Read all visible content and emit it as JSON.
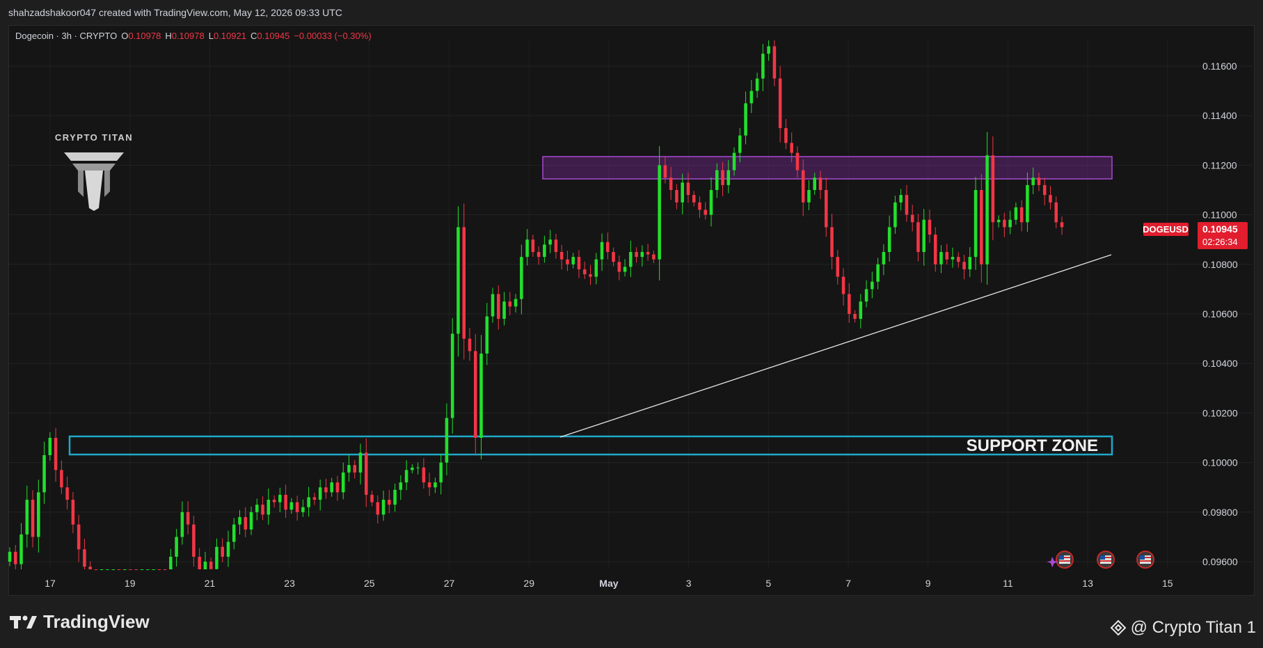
{
  "header": {
    "text": "shahzadshakoor047 created with TradingView.com, May 12, 2026 09:33 UTC"
  },
  "legend": {
    "symbol": "Dogecoin · 3h · CRYPTO",
    "o_label": "O",
    "o_value": "0.10978",
    "h_label": "H",
    "h_value": "0.10978",
    "l_label": "L",
    "l_value": "0.10921",
    "c_label": "C",
    "c_value": "0.10945",
    "change": "−0.00033 (−0.30%)"
  },
  "brand": {
    "name": "CRYPTO TITAN"
  },
  "annotations": {
    "support_label": "SUPPORT ZONE"
  },
  "price_tag": {
    "symbol": "DOGEUSD",
    "price": "0.10945",
    "countdown": "02:26:34"
  },
  "footer": {
    "logo_text": "TradingView",
    "credit": "@ Crypto Titan 1"
  },
  "colors": {
    "up": "#22e02c",
    "down": "#f23645",
    "resistance": "#a64bd1",
    "support": "#1fa9c9",
    "trendline": "#e6e6e6",
    "price_tag": "#e11d2e"
  },
  "chart_data": {
    "type": "candlestick",
    "yticks": [
      "0.09600",
      "0.09800",
      "0.10000",
      "0.10200",
      "0.10400",
      "0.10600",
      "0.10800",
      "0.11000",
      "0.11200",
      "0.11400",
      "0.11600"
    ],
    "ylim": [
      0.0955,
      0.1171
    ],
    "x_labels": [
      "17",
      "19",
      "21",
      "23",
      "25",
      "27",
      "29",
      "May",
      "3",
      "5",
      "7",
      "9",
      "11",
      "13",
      "15"
    ],
    "closes": [
      0.0964,
      0.0959,
      0.0971,
      0.0985,
      0.097,
      0.0988,
      0.1003,
      0.101,
      0.0997,
      0.099,
      0.0985,
      0.0975,
      0.0965,
      0.0958,
      0.0952,
      0.095,
      0.095,
      0.0951,
      0.0951,
      0.095,
      0.0953,
      0.0952,
      0.095,
      0.0951,
      0.0951,
      0.0952,
      0.0951,
      0.0949,
      0.0962,
      0.097,
      0.098,
      0.0975,
      0.0962,
      0.0955,
      0.096,
      0.0957,
      0.0966,
      0.0962,
      0.0968,
      0.0975,
      0.0978,
      0.0973,
      0.098,
      0.0983,
      0.0979,
      0.0985,
      0.0984,
      0.0987,
      0.0981,
      0.0984,
      0.098,
      0.0982,
      0.0986,
      0.0985,
      0.099,
      0.0988,
      0.0992,
      0.0988,
      0.0996,
      0.0999,
      0.0996,
      0.1004,
      0.0987,
      0.0984,
      0.0979,
      0.0985,
      0.0983,
      0.0989,
      0.0992,
      0.0997,
      0.0998,
      0.0998,
      0.0992,
      0.099,
      0.0992,
      0.1,
      0.1018,
      0.1052,
      0.1095,
      0.105,
      0.1045,
      0.101,
      0.1044,
      0.1059,
      0.1068,
      0.1058,
      0.1065,
      0.1063,
      0.1066,
      0.1083,
      0.109,
      0.1085,
      0.1083,
      0.1088,
      0.109,
      0.1085,
      0.1082,
      0.108,
      0.1083,
      0.1078,
      0.1076,
      0.1075,
      0.1082,
      0.1089,
      0.1085,
      0.1081,
      0.1077,
      0.1079,
      0.1085,
      0.1083,
      0.1085,
      0.1084,
      0.1082,
      0.112,
      0.1115,
      0.111,
      0.1105,
      0.1113,
      0.1108,
      0.1105,
      0.1102,
      0.11,
      0.111,
      0.1118,
      0.1112,
      0.1118,
      0.1125,
      0.1132,
      0.1145,
      0.115,
      0.1155,
      0.1165,
      0.1168,
      0.1155,
      0.1135,
      0.1129,
      0.1125,
      0.1118,
      0.1105,
      0.111,
      0.1115,
      0.111,
      0.1095,
      0.1083,
      0.1075,
      0.1068,
      0.106,
      0.1058,
      0.1065,
      0.107,
      0.1073,
      0.108,
      0.1085,
      0.1095,
      0.1105,
      0.1108,
      0.11,
      0.1097,
      0.1085,
      0.1098,
      0.1092,
      0.108,
      0.1085,
      0.1082,
      0.1083,
      0.1081,
      0.1078,
      0.1083,
      0.111,
      0.108,
      0.1124,
      0.1097,
      0.1098,
      0.1095,
      0.1098,
      0.1103,
      0.1097,
      0.1112,
      0.1115,
      0.1112,
      0.1108,
      0.1105,
      0.1097,
      0.1095
    ]
  }
}
